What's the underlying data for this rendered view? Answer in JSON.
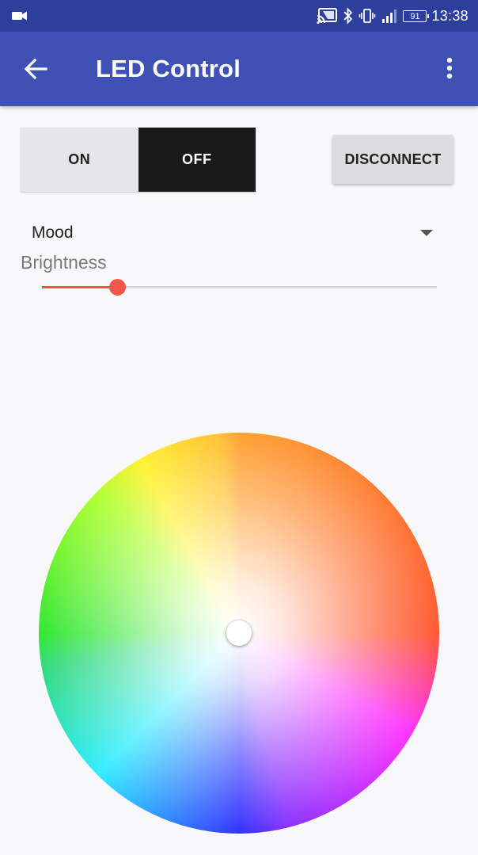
{
  "status_bar": {
    "time": "13:38",
    "battery_level": "91",
    "icons": [
      "video-camera-icon",
      "cast-icon",
      "bluetooth-icon",
      "vibrate-icon",
      "signal-icon",
      "battery-icon"
    ]
  },
  "app_bar": {
    "title": "LED Control",
    "icons": [
      "back-arrow-icon",
      "overflow-menu-icon"
    ]
  },
  "power_toggle": {
    "on_label": "ON",
    "off_label": "OFF",
    "selected": "OFF"
  },
  "disconnect_button": {
    "label": "DISCONNECT"
  },
  "mode_spinner": {
    "selected": "Mood"
  },
  "brightness": {
    "label": "Brightness",
    "value_percent": 19
  },
  "color_wheel": {
    "selected_color": "#ffffff"
  },
  "colors": {
    "status_bar": "#2d3f9d",
    "app_bar": "#3f51b5",
    "accent": "#f4574a",
    "background": "#f8f7f9"
  }
}
